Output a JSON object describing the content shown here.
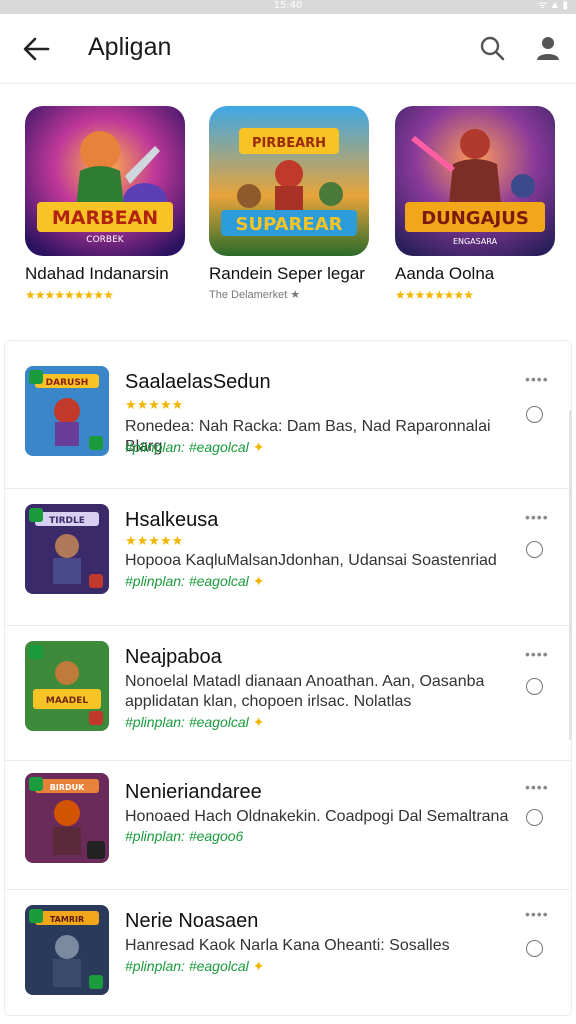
{
  "status": {
    "time": "15:40",
    "icons": "ᯤ ▲ ▮"
  },
  "appbar": {
    "title": "Apligan"
  },
  "featured": [
    {
      "name": "Ndahad Indanarsin",
      "rating": "★★★★★★★★★",
      "sub": "",
      "art_text": "MARBEAN",
      "art_sub": "CORBEK"
    },
    {
      "name": "Randein Seper legar",
      "rating": "★★",
      "sub": "The Delamerket ★",
      "art_text": "SUPAREAR",
      "art_sub": "PIRBEARH"
    },
    {
      "name": "Aanda Oolna",
      "rating": "★★★★★★★★",
      "sub": "",
      "art_text": "DUNGAJUS",
      "art_sub": "ENGASARA"
    }
  ],
  "list": [
    {
      "title": "SaalaelasSedun",
      "stars": "★★★★★",
      "desc": "Ronedea: Nah Racka: Dam Bas, Nad Raparonnalai Blarg",
      "tag": "#plinplan: #eagolcal",
      "art": "DARUSH"
    },
    {
      "title": "Hsalkeusa",
      "stars": "★★★★★",
      "desc": "Hopooa KaqluMalsanJdonhan, Udansai Soastenriad",
      "tag": "#plinplan: #eagolcal",
      "art": "TIRDLE"
    },
    {
      "title": "Neajpaboa",
      "stars": "",
      "desc": "Nonoelal Matadl dianaan Anoathan. Aan, Oasanba applidatan klan, chopoen irlsac. Nolatlas",
      "tag": "#plinplan: #eagolcal",
      "art": "MAADEL"
    },
    {
      "title": "Nenieriandaree",
      "stars": "",
      "desc": "Honoaed Hach Oldnakekin. Coadpogi Dal Semaltrana",
      "tag": "#plinplan: #eagoo6",
      "art": "BIRDUK"
    },
    {
      "title": "Nerie Noasaen",
      "stars": "",
      "desc": "Hanresad Kaok Narla Kana Oheanti: Sosalles",
      "tag": "#plinplan: #eagolcal",
      "art": "TAMRIR"
    }
  ],
  "colors": {
    "star": "#f2b600",
    "tag": "#1a9b3c",
    "divider": "#ececec"
  }
}
